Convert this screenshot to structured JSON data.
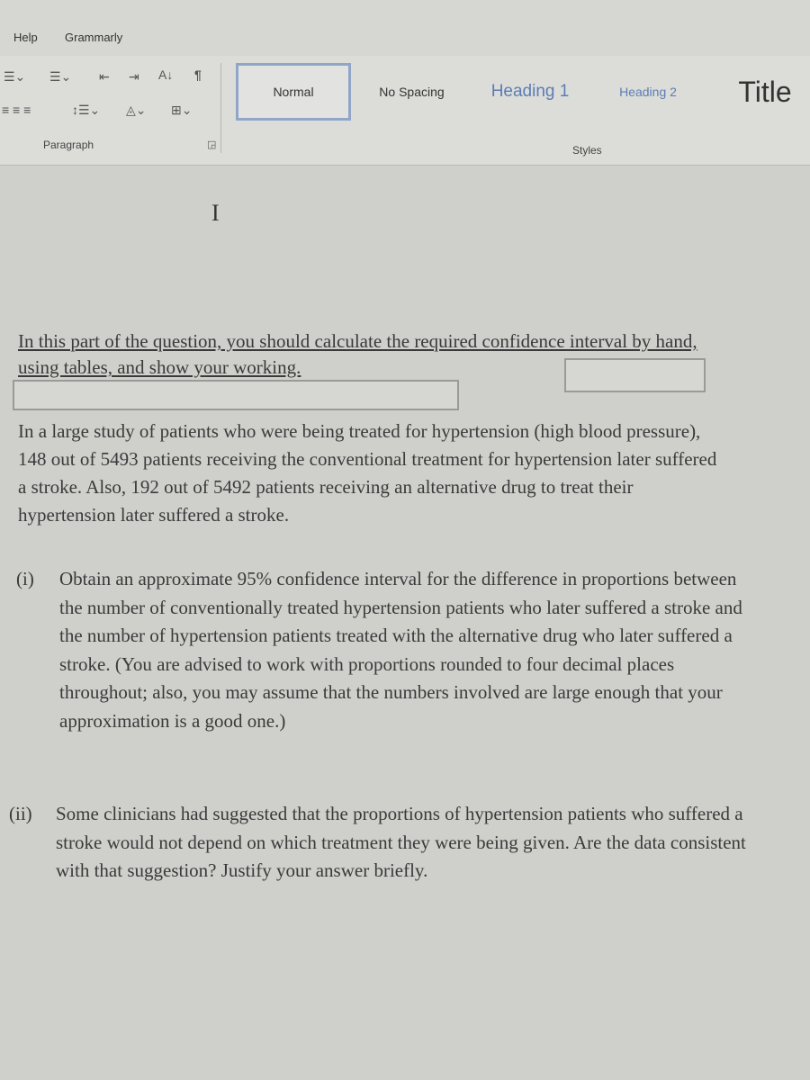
{
  "menu": {
    "help": "Help",
    "grammarly": "Grammarly"
  },
  "ribbon": {
    "paragraph_label": "Paragraph",
    "styles_label": "Styles",
    "styles": [
      "Normal",
      "No Spacing",
      "Heading 1",
      "Heading 2",
      "Title"
    ],
    "selected_style": "Normal",
    "heading_color": "#5b7db5"
  },
  "document": {
    "cursor": "I",
    "intro": "In this part of the question, you should calculate the required confidence interval by hand, using tables, and show your working.",
    "study": "In a large study of patients who were being treated for hypertension (high blood pressure), 148 out of 5493 patients receiving the conventional treatment for hypertension later suffered a stroke. Also, 192 out of 5492 patients receiving an alternative drug to treat their hypertension later suffered a stroke.",
    "parts": [
      {
        "label": "(i)",
        "text": "Obtain an approximate 95% confidence interval for the difference in proportions between the number of conventionally treated hypertension patients who later suffered a stroke and the number of hypertension patients treated with the alternative drug who later suffered a stroke. (You are advised to work with proportions rounded to four decimal places throughout; also, you may assume that the numbers involved are large enough that your approximation is a good one.)"
      },
      {
        "label": "(ii)",
        "text": "Some clinicians had suggested that the proportions of hypertension patients who suffered a stroke would not depend on which treatment they were being given. Are the data consistent with that suggestion? Justify your answer briefly."
      }
    ]
  }
}
